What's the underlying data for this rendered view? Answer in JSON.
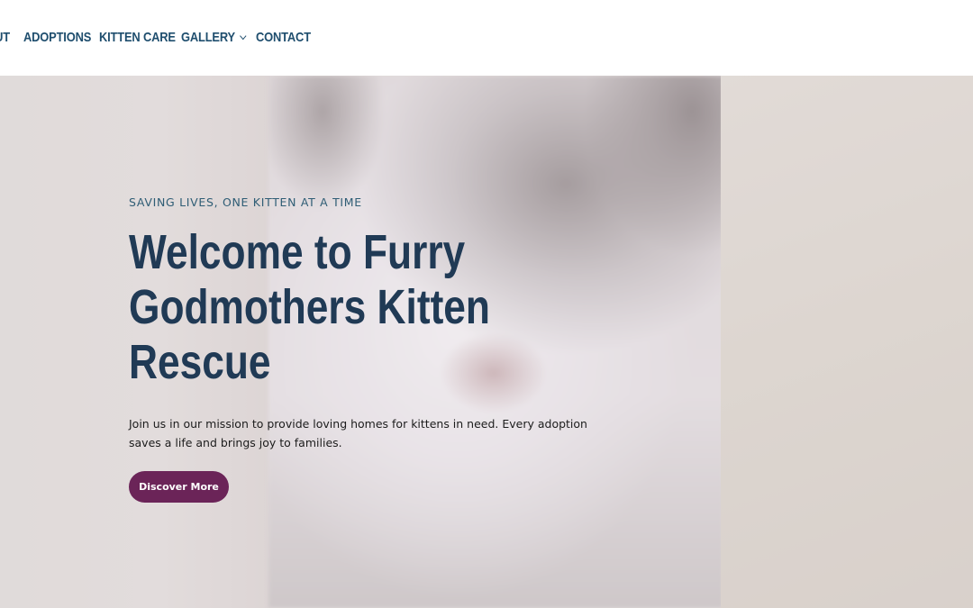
{
  "nav": {
    "items": [
      {
        "label": "ABOUT"
      },
      {
        "label": "ADOPTIONS"
      },
      {
        "label": "KITTEN CARE"
      },
      {
        "label": "GALLERY"
      },
      {
        "label": "CONTACT"
      }
    ],
    "gallery_has_dropdown": true,
    "color": "#1f4e6e"
  },
  "hero": {
    "tagline": "SAVING LIVES, ONE KITTEN AT A TIME",
    "headline": "Welcome to Furry Godmothers Kitten Rescue",
    "description": "Join us in our mission to provide loving homes for kittens in need. Every adoption saves a life and brings joy to families.",
    "cta_label": "Discover More",
    "cta_color": "#6b2458",
    "headline_color": "#203a55",
    "background_image": "kitten-photo"
  }
}
